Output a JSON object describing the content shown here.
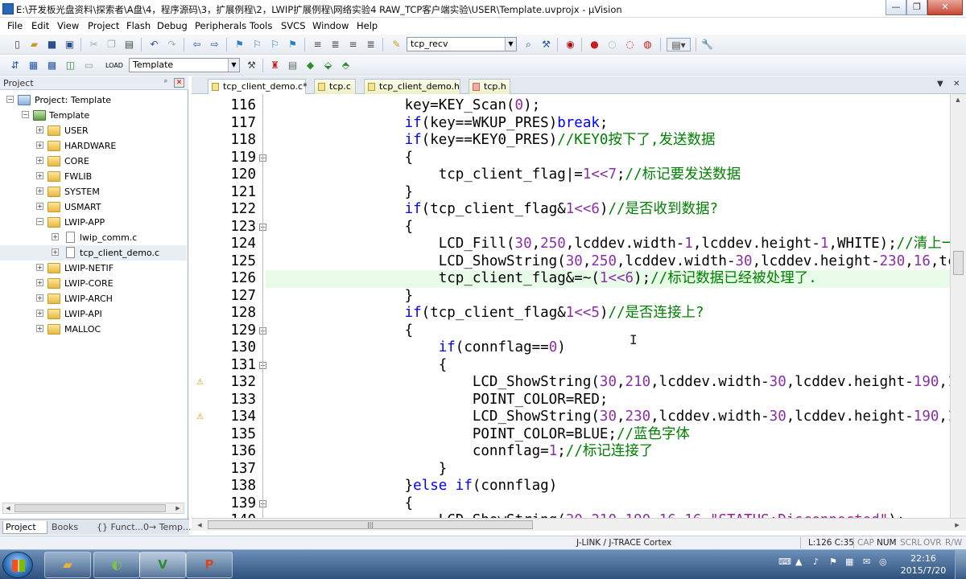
{
  "window": {
    "title": "E:\\开发板光盘资料\\探索者\\A盘\\4，程序源码\\3，扩展例程\\2，LWIP扩展例程\\网络实验4 RAW_TCP客户端实验\\USER\\Template.uvprojx - µVision",
    "minimize": "—",
    "restore": "❐",
    "close": "✕"
  },
  "menu": [
    "File",
    "Edit",
    "View",
    "Project",
    "Flash",
    "Debug",
    "Peripherals",
    "Tools",
    "SVCS",
    "Window",
    "Help"
  ],
  "toolbar1": {
    "find_combo": "tcp_recv"
  },
  "toolbar2": {
    "target_combo": "Template"
  },
  "project_panel": {
    "title": "Project",
    "pin": "ᵖ",
    "close": "✕",
    "tree": [
      {
        "label": "Project: Template",
        "level": 0,
        "expander": "−",
        "icon": "project"
      },
      {
        "label": "Template",
        "level": 1,
        "expander": "−",
        "icon": "target"
      },
      {
        "label": "USER",
        "level": 2,
        "expander": "+",
        "icon": "folder"
      },
      {
        "label": "HARDWARE",
        "level": 2,
        "expander": "+",
        "icon": "folder"
      },
      {
        "label": "CORE",
        "level": 2,
        "expander": "+",
        "icon": "folder"
      },
      {
        "label": "FWLIB",
        "level": 2,
        "expander": "+",
        "icon": "folder"
      },
      {
        "label": "SYSTEM",
        "level": 2,
        "expander": "+",
        "icon": "folder"
      },
      {
        "label": "USMART",
        "level": 2,
        "expander": "+",
        "icon": "folder"
      },
      {
        "label": "LWIP-APP",
        "level": 2,
        "expander": "−",
        "icon": "folder"
      },
      {
        "label": "lwip_comm.c",
        "level": 3,
        "expander": "+",
        "icon": "file"
      },
      {
        "label": "tcp_client_demo.c",
        "level": 3,
        "expander": "+",
        "icon": "file"
      },
      {
        "label": "LWIP-NETIF",
        "level": 2,
        "expander": "+",
        "icon": "folder"
      },
      {
        "label": "LWIP-CORE",
        "level": 2,
        "expander": "+",
        "icon": "folder"
      },
      {
        "label": "LWIP-ARCH",
        "level": 2,
        "expander": "+",
        "icon": "folder"
      },
      {
        "label": "LWIP-API",
        "level": 2,
        "expander": "+",
        "icon": "folder"
      },
      {
        "label": "MALLOC",
        "level": 2,
        "expander": "+",
        "icon": "folder"
      }
    ],
    "tabs": [
      "Project",
      "Books",
      "{} Funct...",
      "0→ Temp..."
    ]
  },
  "editor": {
    "tabs": [
      {
        "label": "tcp_client_demo.c*",
        "active": true
      },
      {
        "label": "tcp.c",
        "active": false
      },
      {
        "label": "tcp_client_demo.h",
        "active": false
      },
      {
        "label": "tcp.h",
        "active": false
      }
    ],
    "lines": [
      {
        "n": "116",
        "tokens": [
          [
            "",
            "                key=KEY_Scan("
          ],
          [
            "num",
            "0"
          ],
          [
            "",
            ");"
          ]
        ]
      },
      {
        "n": "117",
        "tokens": [
          [
            "kw",
            "                if"
          ],
          [
            "",
            "(key==WKUP_PRES)"
          ],
          [
            "kw",
            "break"
          ],
          [
            "",
            ";"
          ]
        ]
      },
      {
        "n": "118",
        "tokens": [
          [
            "kw",
            "                if"
          ],
          [
            "",
            "(key==KEY0_PRES)"
          ],
          [
            "cmt",
            "//KEY0按下了,发送数据"
          ]
        ]
      },
      {
        "n": "119",
        "tokens": [
          [
            "",
            "                {"
          ]
        ]
      },
      {
        "n": "120",
        "tokens": [
          [
            "",
            "                    tcp_client_flag"
          ],
          [
            "",
            "|="
          ],
          [
            "num",
            "1<<7"
          ],
          [
            "",
            ";"
          ],
          [
            "cmt",
            "//标记要发送数据"
          ]
        ]
      },
      {
        "n": "121",
        "tokens": [
          [
            "",
            "                }"
          ]
        ]
      },
      {
        "n": "122",
        "tokens": [
          [
            "kw",
            "                if"
          ],
          [
            "",
            "(tcp_client_flag&"
          ],
          [
            "num",
            "1<<6"
          ],
          [
            "",
            ")"
          ],
          [
            "cmt",
            "//是否收到数据?"
          ]
        ]
      },
      {
        "n": "123",
        "tokens": [
          [
            "",
            "                {"
          ]
        ]
      },
      {
        "n": "124",
        "tokens": [
          [
            "",
            "                    LCD_Fill("
          ],
          [
            "num",
            "30"
          ],
          [
            "",
            ","
          ],
          [
            "num",
            "250"
          ],
          [
            "",
            ",lcddev.width-"
          ],
          [
            "num",
            "1"
          ],
          [
            "",
            ",lcddev.height-"
          ],
          [
            "num",
            "1"
          ],
          [
            "",
            ",WHITE);"
          ],
          [
            "cmt",
            "//清上一次"
          ]
        ]
      },
      {
        "n": "125",
        "tokens": [
          [
            "",
            "                    LCD_ShowString("
          ],
          [
            "num",
            "30"
          ],
          [
            "",
            ","
          ],
          [
            "num",
            "250"
          ],
          [
            "",
            ",lcddev.width-"
          ],
          [
            "num",
            "30"
          ],
          [
            "",
            ",lcddev.height-"
          ],
          [
            "num",
            "230"
          ],
          [
            "",
            ","
          ],
          [
            "num",
            "16"
          ],
          [
            "",
            ",tcp_"
          ]
        ]
      },
      {
        "n": "126",
        "tokens": [
          [
            "",
            "                    tcp_client_flag&=~("
          ],
          [
            "num",
            "1<<6"
          ],
          [
            "",
            ");"
          ],
          [
            "cmt",
            "//标记数据已经被处理了."
          ]
        ]
      },
      {
        "n": "127",
        "tokens": [
          [
            "",
            "                }"
          ]
        ]
      },
      {
        "n": "128",
        "tokens": [
          [
            "kw",
            "                if"
          ],
          [
            "",
            "(tcp_client_flag&"
          ],
          [
            "num",
            "1<<5"
          ],
          [
            "",
            ")"
          ],
          [
            "cmt",
            "//是否连接上?"
          ]
        ]
      },
      {
        "n": "129",
        "tokens": [
          [
            "",
            "                {"
          ]
        ]
      },
      {
        "n": "130",
        "tokens": [
          [
            "kw",
            "                    if"
          ],
          [
            "",
            "(connflag=="
          ],
          [
            "num",
            "0"
          ],
          [
            "",
            ")"
          ]
        ]
      },
      {
        "n": "131",
        "tokens": [
          [
            "",
            "                    {"
          ]
        ]
      },
      {
        "n": "132",
        "tokens": [
          [
            "",
            "                        LCD_ShowString("
          ],
          [
            "num",
            "30"
          ],
          [
            "",
            ","
          ],
          [
            "num",
            "210"
          ],
          [
            "",
            ",lcddev.width-"
          ],
          [
            "num",
            "30"
          ],
          [
            "",
            ",lcddev.height-"
          ],
          [
            "num",
            "190"
          ],
          [
            "",
            ","
          ],
          [
            "num",
            "16"
          ],
          [
            "",
            ",."
          ]
        ]
      },
      {
        "n": "133",
        "tokens": [
          [
            "",
            "                        POINT_COLOR=RED;"
          ]
        ]
      },
      {
        "n": "134",
        "tokens": [
          [
            "",
            "                        LCD_ShowString("
          ],
          [
            "num",
            "30"
          ],
          [
            "",
            ","
          ],
          [
            "num",
            "230"
          ],
          [
            "",
            ",lcddev.width-"
          ],
          [
            "num",
            "30"
          ],
          [
            "",
            ",lcddev.height-"
          ],
          [
            "num",
            "190"
          ],
          [
            "",
            ","
          ],
          [
            "num",
            "16"
          ],
          [
            "",
            ",."
          ]
        ]
      },
      {
        "n": "135",
        "tokens": [
          [
            "",
            "                        POINT_COLOR=BLUE;"
          ],
          [
            "cmt",
            "//蓝色字体"
          ]
        ]
      },
      {
        "n": "136",
        "tokens": [
          [
            "",
            "                        connflag="
          ],
          [
            "num",
            "1"
          ],
          [
            "",
            ";"
          ],
          [
            "cmt",
            "//标记连接了"
          ]
        ]
      },
      {
        "n": "137",
        "tokens": [
          [
            "",
            "                    }"
          ]
        ]
      },
      {
        "n": "138",
        "tokens": [
          [
            "",
            "                }"
          ],
          [
            "kw",
            "else if"
          ],
          [
            "",
            "(connflag)"
          ]
        ]
      },
      {
        "n": "139",
        "tokens": [
          [
            "",
            "                {"
          ]
        ]
      },
      {
        "n": "140",
        "tokens": [
          [
            "",
            "                    LCD_ShowString("
          ],
          [
            "num",
            "30"
          ],
          [
            "",
            ","
          ],
          [
            "num",
            "210"
          ],
          [
            "",
            ","
          ],
          [
            "num",
            "190"
          ],
          [
            "",
            ","
          ],
          [
            "num",
            "16"
          ],
          [
            "",
            ","
          ],
          [
            "num",
            "16"
          ],
          [
            "",
            ","
          ],
          [
            "str",
            "\"STATUS:Disconnected\""
          ],
          [
            "",
            ");"
          ]
        ]
      }
    ],
    "fold_markers": [
      "119",
      "123",
      "129",
      "131",
      "139"
    ],
    "warning_lines": [
      "132",
      "134"
    ]
  },
  "status": {
    "debugger": "J-LINK / J-TRACE Cortex",
    "position": "L:126 C:35",
    "indicators": [
      "CAP",
      "NUM",
      "SCRL",
      "OVR",
      "R/W"
    ]
  },
  "taskbar": {
    "time": "22:16",
    "date": "2015/7/20",
    "apps": [
      "explorer",
      "qq",
      "keil",
      "powerpoint"
    ]
  },
  "colors": {
    "keyword": "#0000ff",
    "number": "#8b2fa8",
    "comment": "#008000",
    "current_line": "#e8fbe9"
  }
}
